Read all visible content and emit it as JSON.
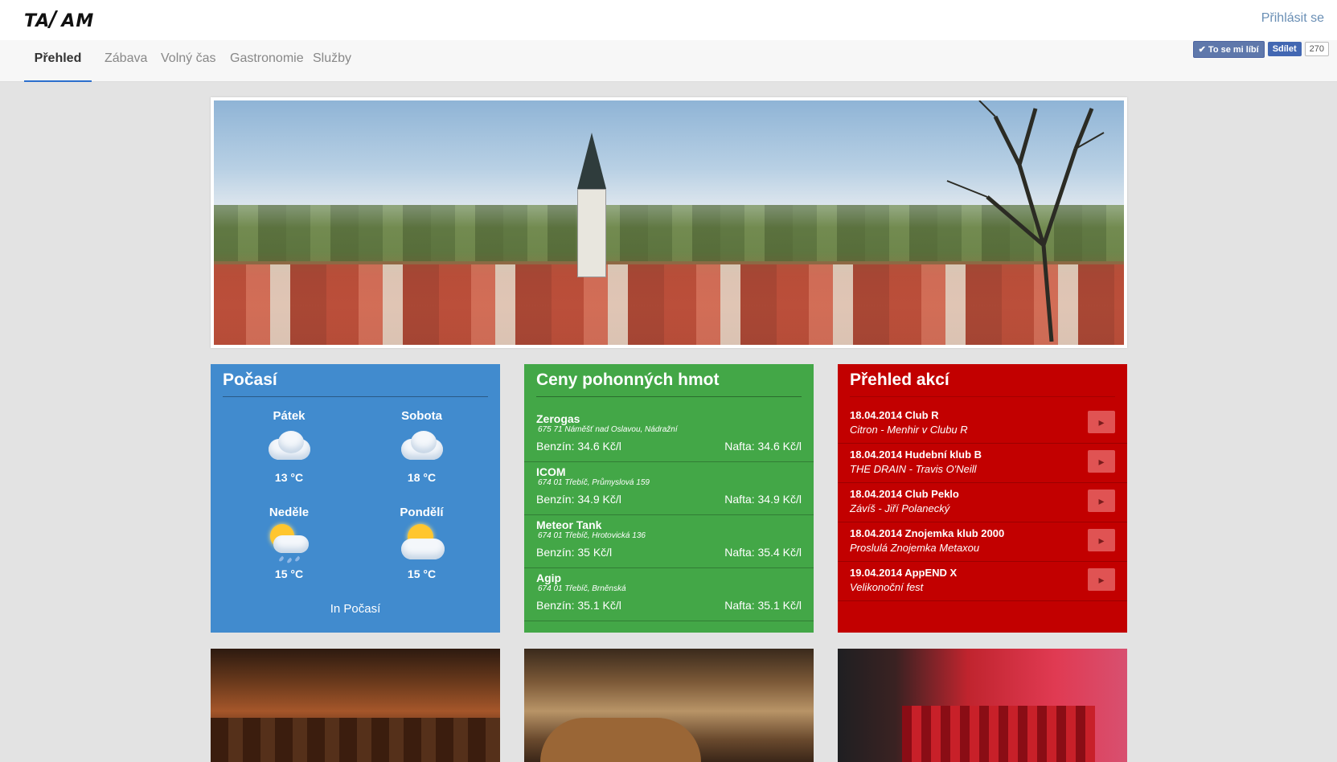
{
  "header": {
    "logo_text": "TAKAM",
    "login_label": "Přihlásit se"
  },
  "nav": {
    "items": [
      {
        "label": "Přehled",
        "active": true
      },
      {
        "label": "Zábava"
      },
      {
        "label": "Volný čas"
      },
      {
        "label": "Gastronomie"
      },
      {
        "label": "Služby"
      }
    ]
  },
  "social": {
    "like_label": "✔ To se mi líbí",
    "share_label": "Sdílet",
    "share_count": "270"
  },
  "weather": {
    "title": "Počasí",
    "days": [
      {
        "day": "Pátek",
        "temp": "13 °C",
        "icon": "cloudy-icon"
      },
      {
        "day": "Sobota",
        "temp": "18 °C",
        "icon": "cloudy-icon"
      },
      {
        "day": "Neděle",
        "temp": "15 °C",
        "icon": "sun-rain-icon"
      },
      {
        "day": "Pondělí",
        "temp": "15 °C",
        "icon": "sun-cloud-icon"
      }
    ],
    "more_label": "In Počasí"
  },
  "fuel": {
    "title": "Ceny pohonných hmot",
    "stations": [
      {
        "name": "Zerogas",
        "address": "675 71 Náměšť nad Oslavou, Nádražní",
        "benzin": "Benzín: 34.6 Kč/l",
        "nafta": "Nafta: 34.6 Kč/l"
      },
      {
        "name": "ICOM",
        "address": "674 01 Třebíč, Průmyslová 159",
        "benzin": "Benzín: 34.9 Kč/l",
        "nafta": "Nafta: 34.9 Kč/l"
      },
      {
        "name": "Meteor Tank",
        "address": "674 01 Třebíč, Hrotovická 136",
        "benzin": "Benzín: 35 Kč/l",
        "nafta": "Nafta: 35.4 Kč/l"
      },
      {
        "name": "Agip",
        "address": "674 01 Třebíč, Brněnská",
        "benzin": "Benzín: 35.1 Kč/l",
        "nafta": "Nafta: 35.1 Kč/l"
      }
    ]
  },
  "events": {
    "title": "Přehled akcí",
    "items": [
      {
        "title": "18.04.2014 Club R",
        "subtitle": "Citron - Menhir v Clubu R"
      },
      {
        "title": "18.04.2014 Hudební klub B",
        "subtitle": "THE DRAIN - Travis O'Neill"
      },
      {
        "title": "18.04.2014 Club Peklo",
        "subtitle": "Závíš - Jiří Polanecký"
      },
      {
        "title": "18.04.2014 Znojemka klub 2000",
        "subtitle": "Proslulá Znojemka Metaxou"
      },
      {
        "title": "19.04.2014 AppEND X",
        "subtitle": "Velikonoční fest"
      }
    ],
    "arrow_icon": "chevron-right-icon"
  },
  "colors": {
    "weather": "#418bce",
    "fuel": "#43a747",
    "events": "#c20000",
    "nav_active": "#2c6fcd"
  }
}
